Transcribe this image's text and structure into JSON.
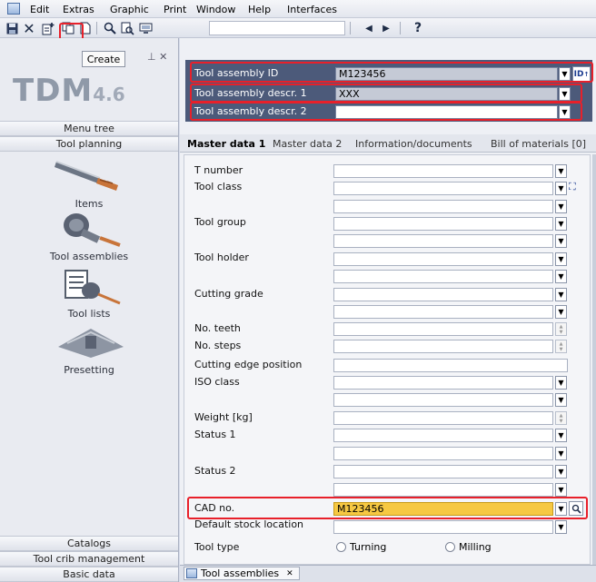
{
  "menubar": {
    "items": [
      "Edit",
      "Extras",
      "Graphic",
      "Print",
      "Window",
      "Help",
      "Interfaces"
    ]
  },
  "toolbar": {
    "icons": [
      "save-icon",
      "delete-icon",
      "new-icon",
      "copy-icon",
      "blank-page-icon",
      "search-icon",
      "find-in-list-icon",
      "scan-icon",
      "nav-prev-icon",
      "nav-next-icon",
      "help-icon"
    ],
    "nav_prev": "◀",
    "nav_next": "▶",
    "help": "?",
    "tooltip": "Create"
  },
  "sidebar": {
    "logo_text": "TDM",
    "logo_version": "4.6",
    "section_headers": [
      "Menu tree",
      "Tool planning"
    ],
    "items": [
      {
        "label": "Items",
        "icon": "drill-icon"
      },
      {
        "label": "Tool assemblies",
        "icon": "tool-assembly-icon"
      },
      {
        "label": "Tool lists",
        "icon": "tool-list-icon"
      },
      {
        "label": "Presetting",
        "icon": "presetting-icon"
      }
    ],
    "footer_headers": [
      "Catalogs",
      "Tool crib management",
      "Basic data"
    ]
  },
  "header": {
    "fields": [
      {
        "label": "Tool assembly ID",
        "value": "M123456"
      },
      {
        "label": "Tool assembly descr. 1",
        "value": "XXX"
      },
      {
        "label": "Tool assembly descr. 2",
        "value": ""
      }
    ],
    "id_button": "ID"
  },
  "tabs": [
    "Master data 1",
    "Master data 2",
    "Information/documents",
    "Bill of materials [0]"
  ],
  "form": {
    "labels": {
      "t_number": "T number",
      "tool_class": "Tool class",
      "tool_group": "Tool group",
      "tool_holder": "Tool holder",
      "cutting_grade": "Cutting grade",
      "no_teeth": "No. teeth",
      "no_steps": "No. steps",
      "cutting_edge_position": "Cutting edge position",
      "iso_class": "ISO class",
      "weight": "Weight [kg]",
      "status1": "Status 1",
      "status2": "Status 2",
      "cad_no": "CAD no.",
      "default_stock_location": "Default stock location",
      "tool_type": "Tool type"
    },
    "cad_no_value": "M123456",
    "tool_type_options": [
      "Turning",
      "Milling"
    ]
  },
  "bottom_tab": {
    "label": "Tool assemblies",
    "close": "✕"
  },
  "colors": {
    "highlight_red": "#e8202a",
    "header_bg": "#4c5a7a",
    "cad_field_bg": "#f6c842"
  }
}
